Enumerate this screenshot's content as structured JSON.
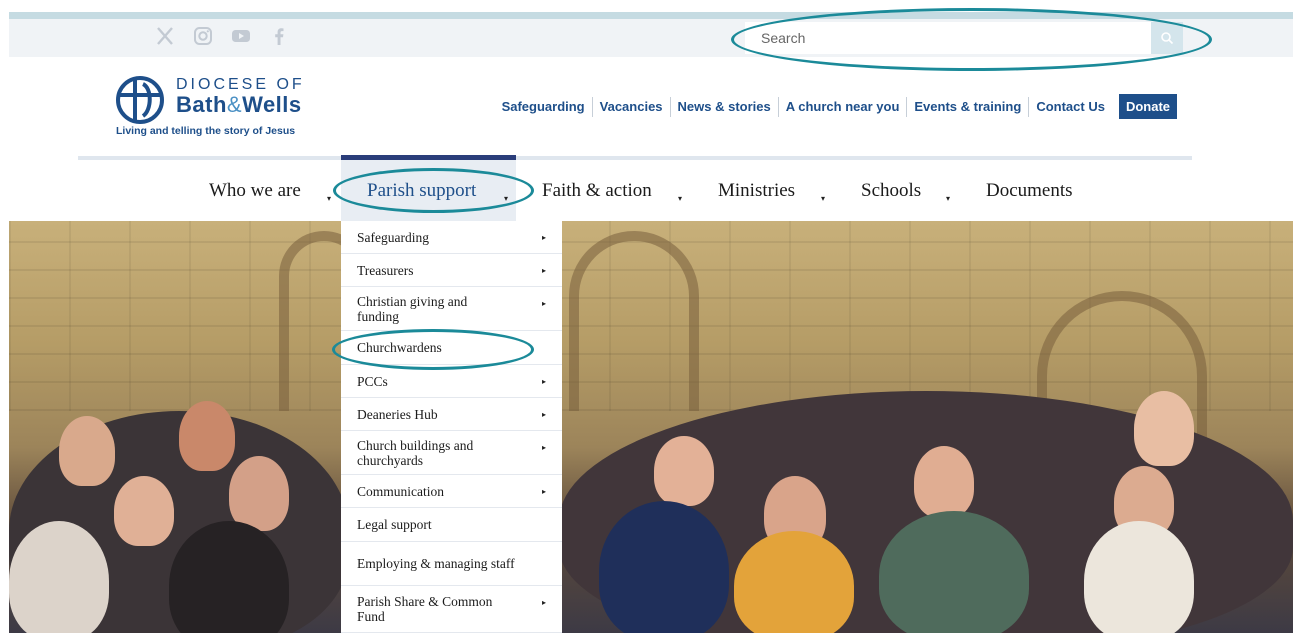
{
  "social": {
    "icons": [
      "x-icon",
      "instagram-icon",
      "youtube-icon",
      "facebook-icon"
    ]
  },
  "search": {
    "placeholder": "Search"
  },
  "logo": {
    "line1": "DIOCESE OF",
    "line2_a": "Bath",
    "line2_amp": "&",
    "line2_b": "Wells",
    "tagline": "Living and telling the story of Jesus"
  },
  "utility_nav": [
    "Safeguarding",
    "Vacancies",
    "News & stories",
    "A church near you",
    "Events & training",
    "Contact Us"
  ],
  "donate_label": "Donate",
  "main_nav": [
    "Who we are",
    "Parish support",
    "Faith & action",
    "Ministries",
    "Schools",
    "Documents"
  ],
  "active_nav": "Parish support",
  "dropdown": [
    {
      "label": "Safeguarding",
      "has_submenu": true
    },
    {
      "label": "Treasurers",
      "has_submenu": true
    },
    {
      "label": "Christian giving and funding",
      "has_submenu": true
    },
    {
      "label": "Churchwardens",
      "has_submenu": false
    },
    {
      "label": "PCCs",
      "has_submenu": true
    },
    {
      "label": "Deaneries Hub",
      "has_submenu": true
    },
    {
      "label": "Church buildings and churchyards",
      "has_submenu": true
    },
    {
      "label": "Communication",
      "has_submenu": true
    },
    {
      "label": "Legal support",
      "has_submenu": false
    },
    {
      "label": "Employing & managing staff",
      "has_submenu": false
    },
    {
      "label": "Parish Share & Common Fund",
      "has_submenu": true
    }
  ],
  "colors": {
    "brand": "#1e4f8a",
    "highlight_ring": "#1b8a99",
    "topbar": "#f0f3f6"
  }
}
